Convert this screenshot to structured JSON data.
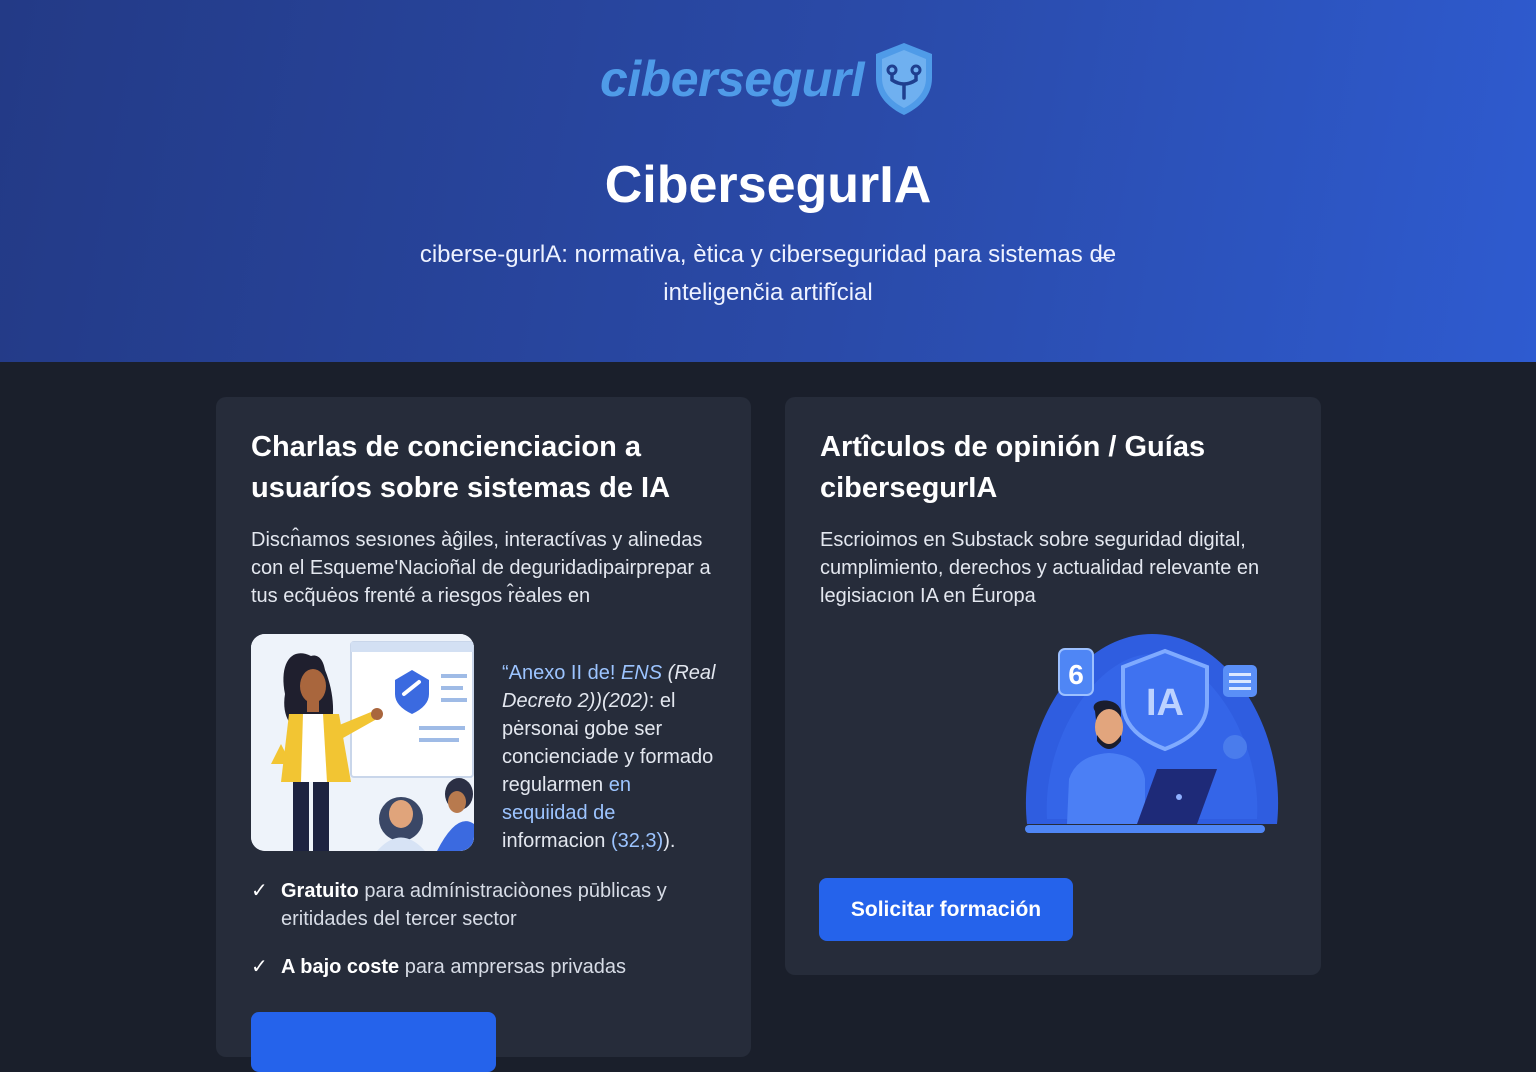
{
  "header": {
    "logo_text": "cibersegurI",
    "title": "CibersegurIA",
    "subtitle": "ciberse-gurlA: normativa, ètica y ciberseguridad para sistemas d̶e inteligenc̆ia artifĭcial"
  },
  "cards": [
    {
      "title": "Charlas de concienciacion a usuaríos sobre sistemas de IA",
      "description": "Discn̂amos sesıones àĝiles, interactívas y alinedas con el Esqueme'Nacioñal de deguridadipairprepar a tus ecq̃uėos frenté a riesgos r̂ėales en",
      "quote": {
        "part1": "“Anexo II de! ",
        "part2": "ENS",
        "part3": "(Real Decreto 2))(202)",
        "part4": ": el pėrsonai gobe ser concienciade y formado regularmen ",
        "part5": "en sequiidad de",
        "part6": " informacion ",
        "part7": "(32,3)",
        "part8": ")."
      },
      "checklist": [
        {
          "bold": "Gratuito",
          "text": " para admínistraciòones pūblicas y eritidades del tercer sector"
        },
        {
          "bold": "A bajo coste",
          "text": " para amprersas privadas"
        }
      ],
      "button_label": ""
    },
    {
      "title": "Artîculos de opinión / Guías cibersegurIA",
      "description": "Escrioimos en Substack sobre seguridad digital, cumplimiento, derechos y actualidad relevante en legisiacıon IA en Éuropa",
      "illustration_text": "IA",
      "badge_text": "6",
      "button_label": "Solicitar formación"
    }
  ],
  "colors": {
    "hero_start": "#233a86",
    "hero_end": "#2e5bd0",
    "page_bg": "#1a1f2b",
    "card_bg": "#262c3a",
    "accent": "#2563eb",
    "logo": "#4f9be8"
  },
  "icons": [
    "shield-logo-icon",
    "check-icon",
    "presenter-illustration",
    "security-analyst-illustration"
  ]
}
